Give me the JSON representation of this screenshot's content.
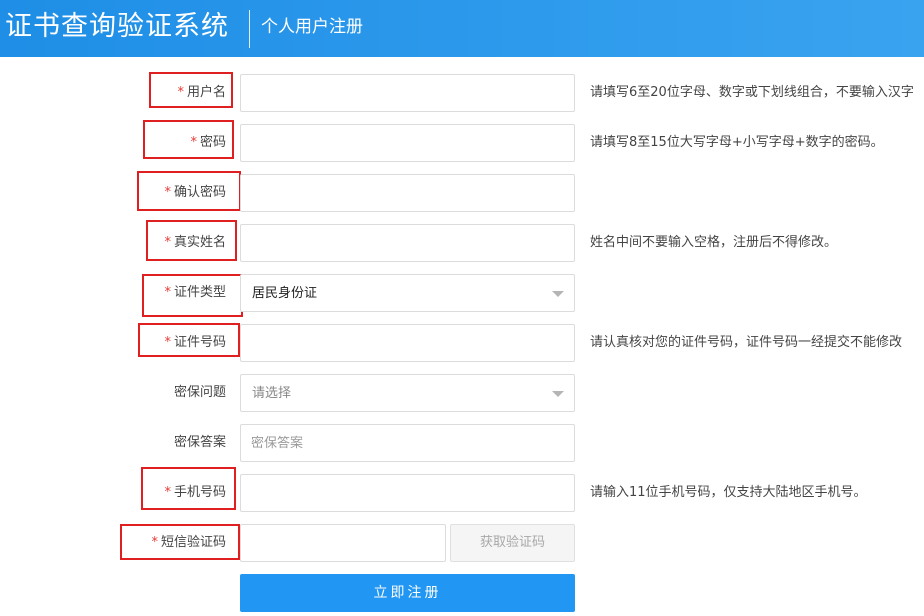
{
  "header": {
    "title": "证书查询验证系统",
    "subtitle": "个人用户注册"
  },
  "form": {
    "required_mark": "*",
    "fields": [
      {
        "label": "用户名",
        "required": true,
        "value": "",
        "placeholder": "",
        "hint": "请填写6至20位字母、数字或下划线组合，不要输入汉字"
      },
      {
        "label": "密码",
        "required": true,
        "value": "",
        "placeholder": "",
        "hint": "请填写8至15位大写字母+小写字母+数字的密码。"
      },
      {
        "label": "确认密码",
        "required": true,
        "value": "",
        "placeholder": "",
        "hint": ""
      },
      {
        "label": "真实姓名",
        "required": true,
        "value": "",
        "placeholder": "",
        "hint": "姓名中间不要输入空格，注册后不得修改。"
      },
      {
        "label": "证件类型",
        "required": true,
        "selected": "居民身份证",
        "hint": ""
      },
      {
        "label": "证件号码",
        "required": true,
        "value": "",
        "placeholder": "",
        "hint": "请认真核对您的证件号码，证件号码一经提交不能修改"
      },
      {
        "label": "密保问题",
        "required": false,
        "selected": "请选择",
        "hint": ""
      },
      {
        "label": "密保答案",
        "required": false,
        "value": "",
        "placeholder": "密保答案",
        "hint": ""
      },
      {
        "label": "手机号码",
        "required": true,
        "value": "",
        "placeholder": "",
        "hint": "请输入11位手机号码，仅支持大陆地区手机号。"
      },
      {
        "label": "短信验证码",
        "required": true,
        "value": "",
        "placeholder": "",
        "hint": ""
      }
    ],
    "get_code_label": "获取验证码",
    "submit_label": "立即注册"
  },
  "colors": {
    "header_bg": "#2196f3",
    "highlight_box": "#e02020",
    "required_mark": "#e53935",
    "submit_bg": "#2196f3"
  }
}
